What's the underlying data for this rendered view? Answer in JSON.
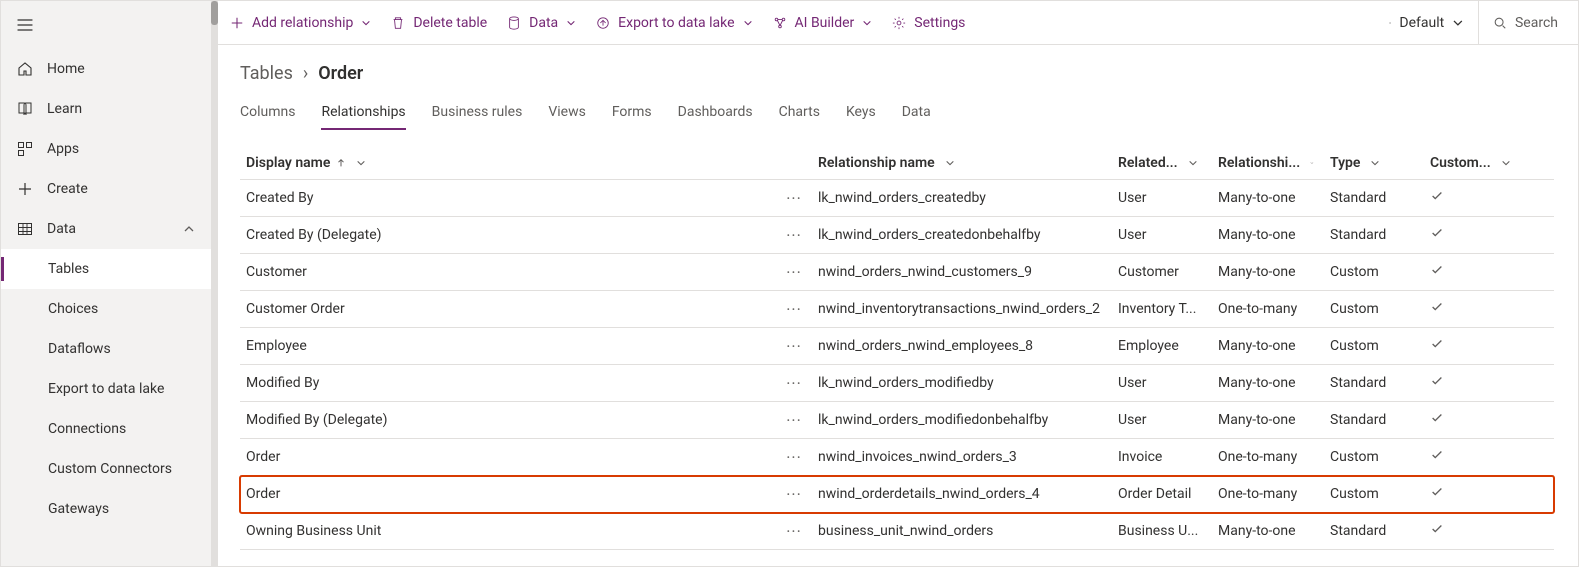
{
  "sidebar": {
    "items": [
      {
        "label": "Home"
      },
      {
        "label": "Learn"
      },
      {
        "label": "Apps"
      },
      {
        "label": "Create"
      },
      {
        "label": "Data"
      },
      {
        "label": "Tables"
      },
      {
        "label": "Choices"
      },
      {
        "label": "Dataflows"
      },
      {
        "label": "Export to data lake"
      },
      {
        "label": "Connections"
      },
      {
        "label": "Custom Connectors"
      },
      {
        "label": "Gateways"
      }
    ]
  },
  "cmdbar": {
    "add_relationship": "Add relationship",
    "delete_table": "Delete table",
    "data": "Data",
    "export_data_lake": "Export to data lake",
    "ai_builder": "AI Builder",
    "settings": "Settings",
    "default": "Default",
    "search_placeholder": "Search"
  },
  "breadcrumb": {
    "root": "Tables",
    "current": "Order"
  },
  "tabs": [
    {
      "label": "Columns"
    },
    {
      "label": "Relationships"
    },
    {
      "label": "Business rules"
    },
    {
      "label": "Views"
    },
    {
      "label": "Forms"
    },
    {
      "label": "Dashboards"
    },
    {
      "label": "Charts"
    },
    {
      "label": "Keys"
    },
    {
      "label": "Data"
    }
  ],
  "table": {
    "headers": {
      "display": "Display name",
      "relname": "Relationship name",
      "related": "Related...",
      "reltype": "Relationshi...",
      "type": "Type",
      "custom": "Custom..."
    },
    "rows": [
      {
        "display": "Created By",
        "relname": "lk_nwind_orders_createdby",
        "related": "User",
        "reltype": "Many-to-one",
        "type": "Standard",
        "custom": "✓"
      },
      {
        "display": "Created By (Delegate)",
        "relname": "lk_nwind_orders_createdonbehalfby",
        "related": "User",
        "reltype": "Many-to-one",
        "type": "Standard",
        "custom": "✓"
      },
      {
        "display": "Customer",
        "relname": "nwind_orders_nwind_customers_9",
        "related": "Customer",
        "reltype": "Many-to-one",
        "type": "Custom",
        "custom": "✓"
      },
      {
        "display": "Customer Order",
        "relname": "nwind_inventorytransactions_nwind_orders_2",
        "related": "Inventory T...",
        "reltype": "One-to-many",
        "type": "Custom",
        "custom": "✓"
      },
      {
        "display": "Employee",
        "relname": "nwind_orders_nwind_employees_8",
        "related": "Employee",
        "reltype": "Many-to-one",
        "type": "Custom",
        "custom": "✓"
      },
      {
        "display": "Modified By",
        "relname": "lk_nwind_orders_modifiedby",
        "related": "User",
        "reltype": "Many-to-one",
        "type": "Standard",
        "custom": "✓"
      },
      {
        "display": "Modified By (Delegate)",
        "relname": "lk_nwind_orders_modifiedonbehalfby",
        "related": "User",
        "reltype": "Many-to-one",
        "type": "Standard",
        "custom": "✓"
      },
      {
        "display": "Order",
        "relname": "nwind_invoices_nwind_orders_3",
        "related": "Invoice",
        "reltype": "One-to-many",
        "type": "Custom",
        "custom": "✓"
      },
      {
        "display": "Order",
        "relname": "nwind_orderdetails_nwind_orders_4",
        "related": "Order Detail",
        "reltype": "One-to-many",
        "type": "Custom",
        "custom": "✓",
        "highlight": true
      },
      {
        "display": "Owning Business Unit",
        "relname": "business_unit_nwind_orders",
        "related": "Business U...",
        "reltype": "Many-to-one",
        "type": "Standard",
        "custom": "✓"
      }
    ]
  }
}
